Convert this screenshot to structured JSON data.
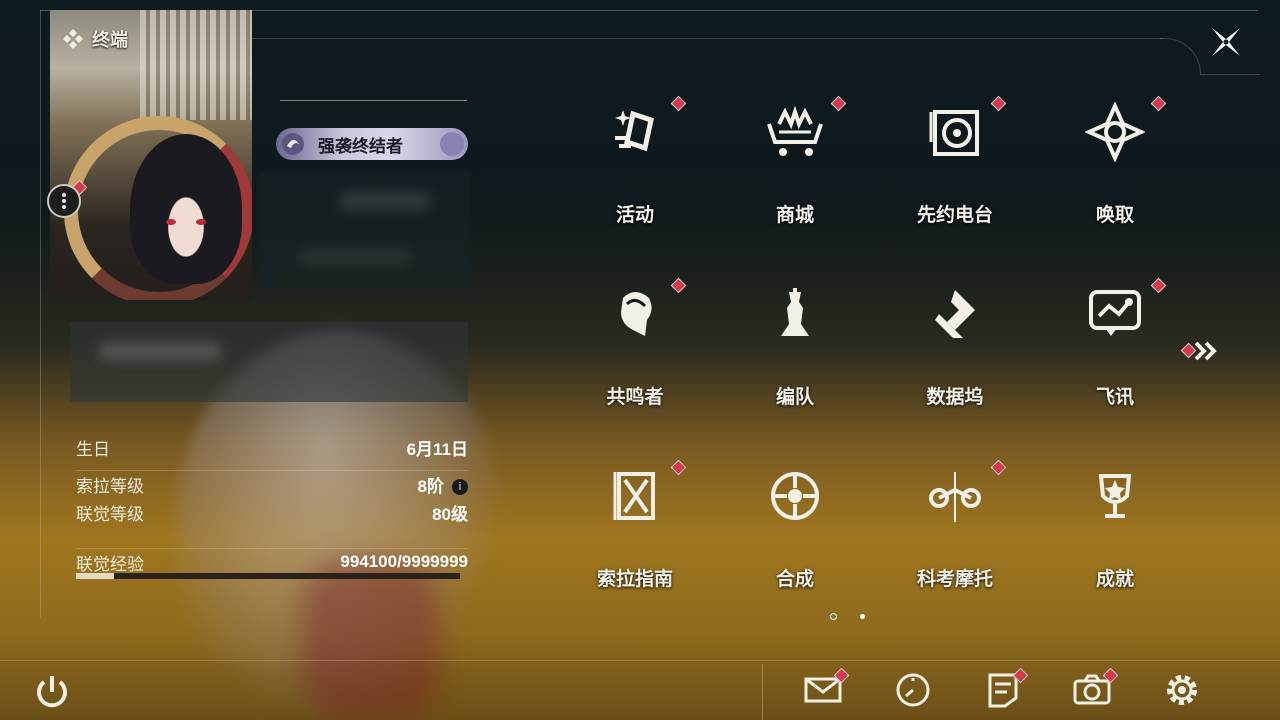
{
  "header": {
    "terminal_label": "终端"
  },
  "profile": {
    "title_badge": "强袭终结者",
    "info": [
      {
        "label": "生日",
        "value": "6月11日"
      },
      {
        "label": "索拉等级",
        "value": "8阶"
      },
      {
        "label": "联觉等级",
        "value": "80级"
      },
      {
        "label": "联觉经验",
        "value": "994100/9999999"
      }
    ],
    "exp_progress": 0.0994,
    "info_icon": "i"
  },
  "menu": {
    "items": [
      {
        "label": "活动",
        "icon": "activity-icon",
        "badge": true
      },
      {
        "label": "商城",
        "icon": "shop-cart-icon",
        "badge": true
      },
      {
        "label": "先约电台",
        "icon": "radio-icon",
        "badge": true
      },
      {
        "label": "唤取",
        "icon": "summon-compass-icon",
        "badge": true
      },
      {
        "label": "共鸣者",
        "icon": "resonator-head-icon",
        "badge": true
      },
      {
        "label": "编队",
        "icon": "chess-team-icon",
        "badge": false
      },
      {
        "label": "数据坞",
        "icon": "data-dock-icon",
        "badge": false
      },
      {
        "label": "飞讯",
        "icon": "message-bubble-icon",
        "badge": true
      },
      {
        "label": "索拉指南",
        "icon": "guide-book-icon",
        "badge": true
      },
      {
        "label": "合成",
        "icon": "synthesis-icon",
        "badge": false
      },
      {
        "label": "科考摩托",
        "icon": "motorcycle-icon",
        "badge": true
      },
      {
        "label": "成就",
        "icon": "trophy-icon",
        "badge": false
      }
    ],
    "page_current": 1,
    "page_total": 2
  },
  "bottom_bar": {
    "buttons": [
      {
        "name": "mail",
        "icon": "mail-icon",
        "badge": true
      },
      {
        "name": "clock",
        "icon": "clock-icon",
        "badge": false
      },
      {
        "name": "notice",
        "icon": "notice-icon",
        "badge": true
      },
      {
        "name": "camera",
        "icon": "camera-icon",
        "badge": true
      },
      {
        "name": "settings",
        "icon": "settings-gear-icon",
        "badge": false
      }
    ]
  },
  "colors": {
    "badge_red": "#d63a4a",
    "accent_cream": "#f2efe6",
    "title_badge": "#c9c6de"
  }
}
